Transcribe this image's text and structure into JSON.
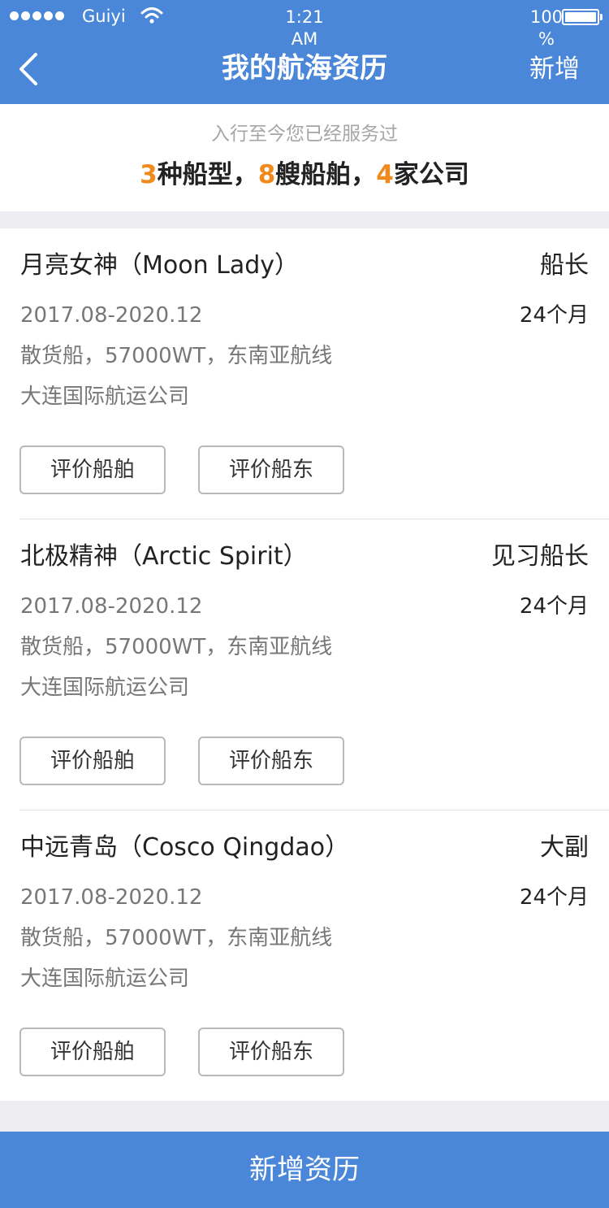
{
  "status_bar": {
    "carrier": "Guiyi",
    "time_line1": "1:21",
    "time_line2": "AM",
    "battery_line1": "100",
    "battery_line2": "%",
    "battery_level": 1.0
  },
  "nav": {
    "title": "我的航海资历",
    "add_label": "新增",
    "back_icon": "chevron-left-icon"
  },
  "summary": {
    "subtitle": "入行至今您已经服务过",
    "ship_types_count": "3",
    "ship_types_label": "种船型，",
    "ships_count": "8",
    "ships_label": "艘船舶，",
    "companies_count": "4",
    "companies_label": "家公司"
  },
  "records": [
    {
      "ship_name": "月亮女神（Moon Lady）",
      "rank": "船长",
      "period": "2017.08-2020.12",
      "duration": "24个月",
      "ship_info": "散货船，57000WT，东南亚航线",
      "company": "大连国际航运公司",
      "rate_ship_label": "评价船舶",
      "rate_owner_label": "评价船东"
    },
    {
      "ship_name": "北极精神（Arctic Spirit）",
      "rank": "见习船长",
      "period": "2017.08-2020.12",
      "duration": "24个月",
      "ship_info": "散货船，57000WT，东南亚航线",
      "company": "大连国际航运公司",
      "rate_ship_label": "评价船舶",
      "rate_owner_label": "评价船东"
    },
    {
      "ship_name": "中远青岛（Cosco Qingdao）",
      "rank": "大副",
      "period": "2017.08-2020.12",
      "duration": "24个月",
      "ship_info": "散货船，57000WT，东南亚航线",
      "company": "大连国际航运公司",
      "rate_ship_label": "评价船舶",
      "rate_owner_label": "评价船东"
    }
  ],
  "bottom_button": {
    "label": "新增资历"
  },
  "colors": {
    "primary": "#4a87d8",
    "highlight": "#f08a1c",
    "text_primary": "#222222",
    "text_secondary": "#777777"
  }
}
